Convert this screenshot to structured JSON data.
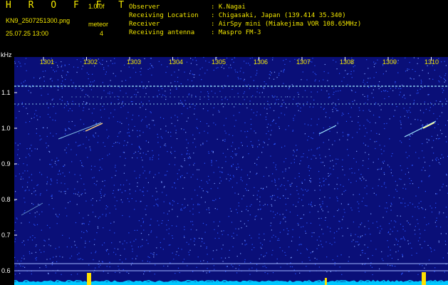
{
  "header": {
    "logo": "H R O F F T",
    "version": "1.0.0f",
    "filename": "KN9_2507251300.png",
    "meteor_label": "meteor",
    "meteor_count": "4",
    "datetime": "25.07.25 13:00",
    "info": [
      {
        "label": "Observer",
        "value": ": K.Nagai"
      },
      {
        "label": "Receiving Location",
        "value": ": Chigasaki, Japan (139.414 35.340)"
      },
      {
        "label": "Receiver",
        "value": ": AirSpy mini (Miakejima VOR 108.65MHz)"
      },
      {
        "label": "Receiving antenna",
        "value": ": Maspro FM-3"
      }
    ]
  },
  "spectrogram": {
    "unit_label": "kHz",
    "y_ticks": [
      "1.1",
      "1.0",
      "0.9",
      "0.8",
      "0.7",
      "0.6"
    ],
    "x_ticks": [
      "1301",
      "1302",
      "1303",
      "1304",
      "1305",
      "1306",
      "1307",
      "1308",
      "1309",
      "1310"
    ],
    "background_color": "#0a0f78",
    "noise_color": "#2a55ff",
    "trace_color": "#9fe8ff",
    "meteor_color": "#ffd080",
    "baseline_color": "#00c8ff",
    "marker_color": "#ffe000"
  }
}
